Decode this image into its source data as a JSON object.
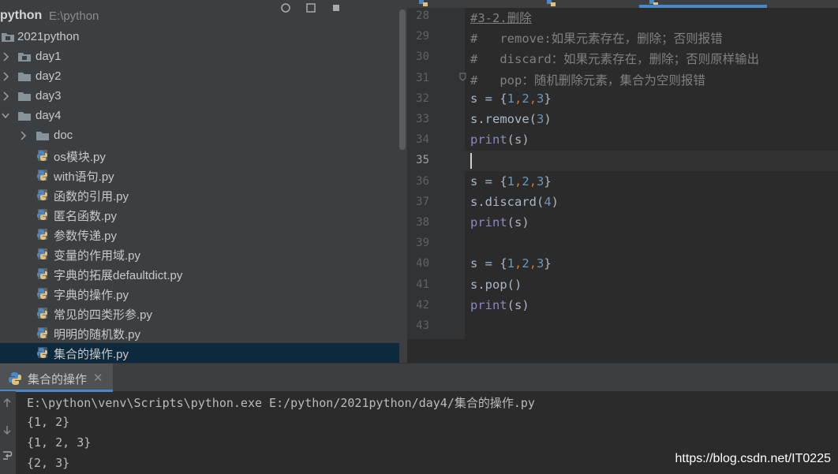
{
  "project": {
    "title": "python",
    "path": "E:\\python",
    "tree": [
      {
        "label": "2021python",
        "type": "folder-module",
        "expanded": true,
        "depth": 0
      },
      {
        "label": "day1",
        "type": "folder-module",
        "expanded": false,
        "depth": 1
      },
      {
        "label": "day2",
        "type": "folder",
        "expanded": false,
        "depth": 1
      },
      {
        "label": "day3",
        "type": "folder",
        "expanded": false,
        "depth": 1
      },
      {
        "label": "day4",
        "type": "folder",
        "expanded": true,
        "depth": 1
      },
      {
        "label": "doc",
        "type": "folder",
        "expanded": false,
        "depth": 2
      },
      {
        "label": "os模块.py",
        "type": "python-file",
        "depth": 2
      },
      {
        "label": "with语句.py",
        "type": "python-file",
        "depth": 2
      },
      {
        "label": "函数的引用.py",
        "type": "python-file",
        "depth": 2
      },
      {
        "label": "匿名函数.py",
        "type": "python-file",
        "depth": 2
      },
      {
        "label": "参数传递.py",
        "type": "python-file",
        "depth": 2
      },
      {
        "label": "变量的作用域.py",
        "type": "python-file",
        "depth": 2
      },
      {
        "label": "字典的拓展defaultdict.py",
        "type": "python-file",
        "depth": 2
      },
      {
        "label": "字典的操作.py",
        "type": "python-file",
        "depth": 2
      },
      {
        "label": "常见的四类形参.py",
        "type": "python-file",
        "depth": 2
      },
      {
        "label": "明明的随机数.py",
        "type": "python-file",
        "depth": 2
      },
      {
        "label": "集合的操作.py",
        "type": "python-file",
        "depth": 2,
        "selected": true
      }
    ]
  },
  "editor": {
    "current_line": "35",
    "lines": [
      {
        "n": "28",
        "text": "#3-2.删除"
      },
      {
        "n": "29",
        "text": "#   remove:如果元素存在，删除；否则报错"
      },
      {
        "n": "30",
        "text": "#   discard：如果元素存在，删除；否则原样输出"
      },
      {
        "n": "31",
        "text": "#   pop：随机删除元素，集合为空则报错"
      },
      {
        "n": "32",
        "text": "s = {1,2,3}"
      },
      {
        "n": "33",
        "text": "s.remove(3)"
      },
      {
        "n": "34",
        "text": "print(s)"
      },
      {
        "n": "35",
        "text": ""
      },
      {
        "n": "36",
        "text": "s = {1,2,3}"
      },
      {
        "n": "37",
        "text": "s.discard(4)"
      },
      {
        "n": "38",
        "text": "print(s)"
      },
      {
        "n": "39",
        "text": ""
      },
      {
        "n": "40",
        "text": "s = {1,2,3}"
      },
      {
        "n": "41",
        "text": "s.pop()"
      },
      {
        "n": "42",
        "text": "print(s)"
      },
      {
        "n": "43",
        "text": ""
      }
    ]
  },
  "run": {
    "tab_label": "集合的操作",
    "close_symbol": "✕",
    "output": [
      "E:\\python\\venv\\Scripts\\python.exe E:/python/2021python/day4/集合的操作.py",
      "{1, 2}",
      "{1, 2, 3}",
      "{2, 3}"
    ]
  },
  "watermark": "https://blog.csdn.net/IT0225",
  "colors": {
    "panel_bg": "#3c3f41",
    "editor_bg": "#2b2b2b",
    "selection": "#0d293e",
    "accent": "#4a88c7",
    "keyword_orange": "#cc7832",
    "number_blue": "#6897bb",
    "builtin_purple": "#8888c6",
    "comment_gray": "#808080"
  }
}
